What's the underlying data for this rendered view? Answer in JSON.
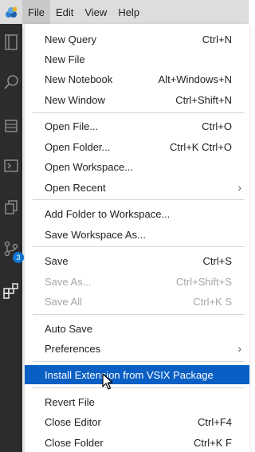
{
  "titlebar": {
    "app_icon": "vscode-logo-icon",
    "menus": [
      "File",
      "Edit",
      "View",
      "Help"
    ],
    "active_menu": "File"
  },
  "activitybar": {
    "icons": [
      "explorer-icon",
      "search-icon",
      "notebook-icon",
      "terminal-icon",
      "copy-icon",
      "source-control-icon",
      "extensions-icon"
    ],
    "source_control_badge": "3"
  },
  "file_menu": {
    "items": [
      {
        "label": "New Query",
        "shortcut": "Ctrl+N"
      },
      {
        "label": "New File",
        "shortcut": ""
      },
      {
        "label": "New Notebook",
        "shortcut": "Alt+Windows+N"
      },
      {
        "label": "New Window",
        "shortcut": "Ctrl+Shift+N"
      },
      {
        "label": "Open File...",
        "shortcut": "Ctrl+O"
      },
      {
        "label": "Open Folder...",
        "shortcut": "Ctrl+K Ctrl+O"
      },
      {
        "label": "Open Workspace...",
        "shortcut": ""
      },
      {
        "label": "Open Recent",
        "shortcut": "",
        "submenu": true
      },
      {
        "label": "Add Folder to Workspace...",
        "shortcut": ""
      },
      {
        "label": "Save Workspace As...",
        "shortcut": ""
      },
      {
        "label": "Save",
        "shortcut": "Ctrl+S"
      },
      {
        "label": "Save As...",
        "shortcut": "Ctrl+Shift+S",
        "disabled": true
      },
      {
        "label": "Save All",
        "shortcut": "Ctrl+K S",
        "disabled": true
      },
      {
        "label": "Auto Save",
        "shortcut": ""
      },
      {
        "label": "Preferences",
        "shortcut": "",
        "submenu": true
      },
      {
        "label": "Install Extension from VSIX Package",
        "shortcut": "",
        "highlighted": true
      },
      {
        "label": "Revert File",
        "shortcut": ""
      },
      {
        "label": "Close Editor",
        "shortcut": "Ctrl+F4"
      },
      {
        "label": "Close Folder",
        "shortcut": "Ctrl+K F"
      }
    ]
  },
  "colors": {
    "highlight": "#0a5fc4",
    "activitybar": "#2c2c2c",
    "badge": "#0e78d4"
  }
}
